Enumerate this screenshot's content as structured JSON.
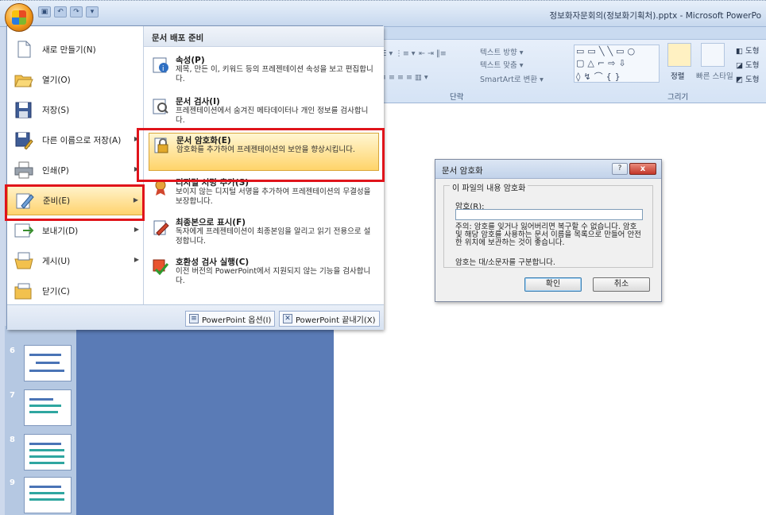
{
  "window": {
    "title": "정보화자문회의(정보화기획처).pptx - Microsoft PowerPo"
  },
  "ribbon": {
    "text_direction": "텍스트 방향",
    "text_align": "텍스트 맞춤",
    "smartart_convert": "SmartArt로 변환",
    "arrange": "정렬",
    "quick_styles": "빠른 스타일",
    "shape_fill": "도형",
    "shape_outline": "도형",
    "shape_effects": "도형",
    "group_paragraph": "단락",
    "group_drawing": "그리기"
  },
  "office_menu": {
    "items": [
      {
        "label": "새로 만들기(N)",
        "icon": "new-document-icon",
        "has_arrow": false
      },
      {
        "label": "열기(O)",
        "icon": "open-folder-icon",
        "has_arrow": false
      },
      {
        "label": "저장(S)",
        "icon": "save-icon",
        "has_arrow": false
      },
      {
        "label": "다른 이름으로 저장(A)",
        "icon": "save-as-icon",
        "has_arrow": true
      },
      {
        "label": "인쇄(P)",
        "icon": "printer-icon",
        "has_arrow": true
      },
      {
        "label": "준비(E)",
        "icon": "prepare-pen-icon",
        "has_arrow": true,
        "selected": true
      },
      {
        "label": "보내기(D)",
        "icon": "send-icon",
        "has_arrow": true
      },
      {
        "label": "게시(U)",
        "icon": "publish-icon",
        "has_arrow": true
      },
      {
        "label": "닫기(C)",
        "icon": "close-folder-icon",
        "has_arrow": false
      }
    ],
    "submenu": {
      "header": "문서 배포 준비",
      "items": [
        {
          "title": "속성(P)",
          "desc": "제목, 만든 이, 키워드 등의 프레젠테이션 속성을 보고 편집합니다.",
          "icon": "properties-icon"
        },
        {
          "title": "문서 검사(I)",
          "desc": "프레젠테이션에서 숨겨진 메타데이터나 개인 정보를 검사합니다.",
          "icon": "inspect-document-icon"
        },
        {
          "title": "문서 암호화(E)",
          "desc": "암호화를 추가하여 프레젠테이션의 보안을 향상시킵니다.",
          "icon": "encrypt-lock-icon",
          "selected": true
        },
        {
          "title": "디지털 서명 추가(S)",
          "desc": "보이지 않는 디지털 서명을 추가하여 프레젠테이션의 무결성을 보장합니다.",
          "icon": "digital-signature-icon"
        },
        {
          "title": "최종본으로 표시(F)",
          "desc": "독자에게 프레젠테이션이 최종본임을 알리고 읽기 전용으로 설정합니다.",
          "icon": "mark-final-icon"
        },
        {
          "title": "호환성 검사 실행(C)",
          "desc": "이전 버전의 PowerPoint에서 지원되지 않는 기능을 검사합니다.",
          "icon": "compatibility-check-icon"
        }
      ]
    },
    "options_button": "PowerPoint 옵션(I)",
    "exit_button": "PowerPoint 끝내기(X)"
  },
  "slides": [
    {
      "number": "6"
    },
    {
      "number": "7"
    },
    {
      "number": "8"
    },
    {
      "number": "9"
    }
  ],
  "dialog": {
    "title": "문서 암호화",
    "help": "?",
    "close": "x",
    "group_label": "이 파일의 내용 암호화",
    "password_label": "암호(R):",
    "password_value": "",
    "warning": "주의: 암호를 잊거나 잃어버리면 복구할 수 없습니다. 암호 및 해당 암호를 사용하는 문서 이름을 목록으로 만들어 안전한 위치에 보관하는 것이 좋습니다.",
    "case_note": "암호는 대/소문자를 구분합니다.",
    "ok": "확인",
    "cancel": "취소"
  }
}
